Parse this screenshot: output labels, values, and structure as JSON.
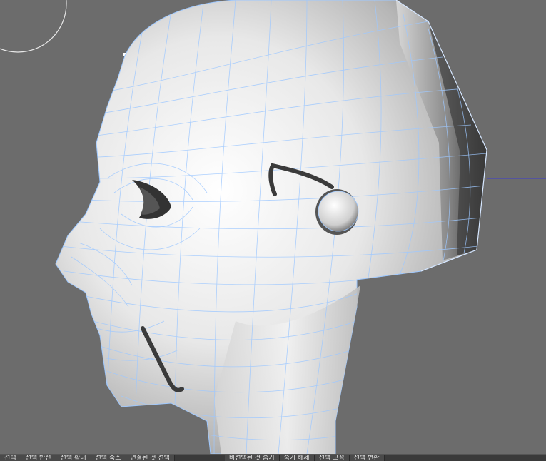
{
  "viewport": {
    "background": "#6c6c6c",
    "mesh_color": "#9ec8ff",
    "selection_color": "#3b3b3b"
  },
  "bottom_menu": {
    "items": [
      {
        "label": "선택"
      },
      {
        "label": "선택 반전"
      },
      {
        "label": "선택 확대"
      },
      {
        "label": "선택 축소"
      },
      {
        "label": "연결된 것 선택"
      },
      {
        "label": "비선택된 것 숨기"
      },
      {
        "label": "숨기 해제"
      },
      {
        "label": "선택 고정"
      },
      {
        "label": "선택 변환"
      }
    ]
  }
}
